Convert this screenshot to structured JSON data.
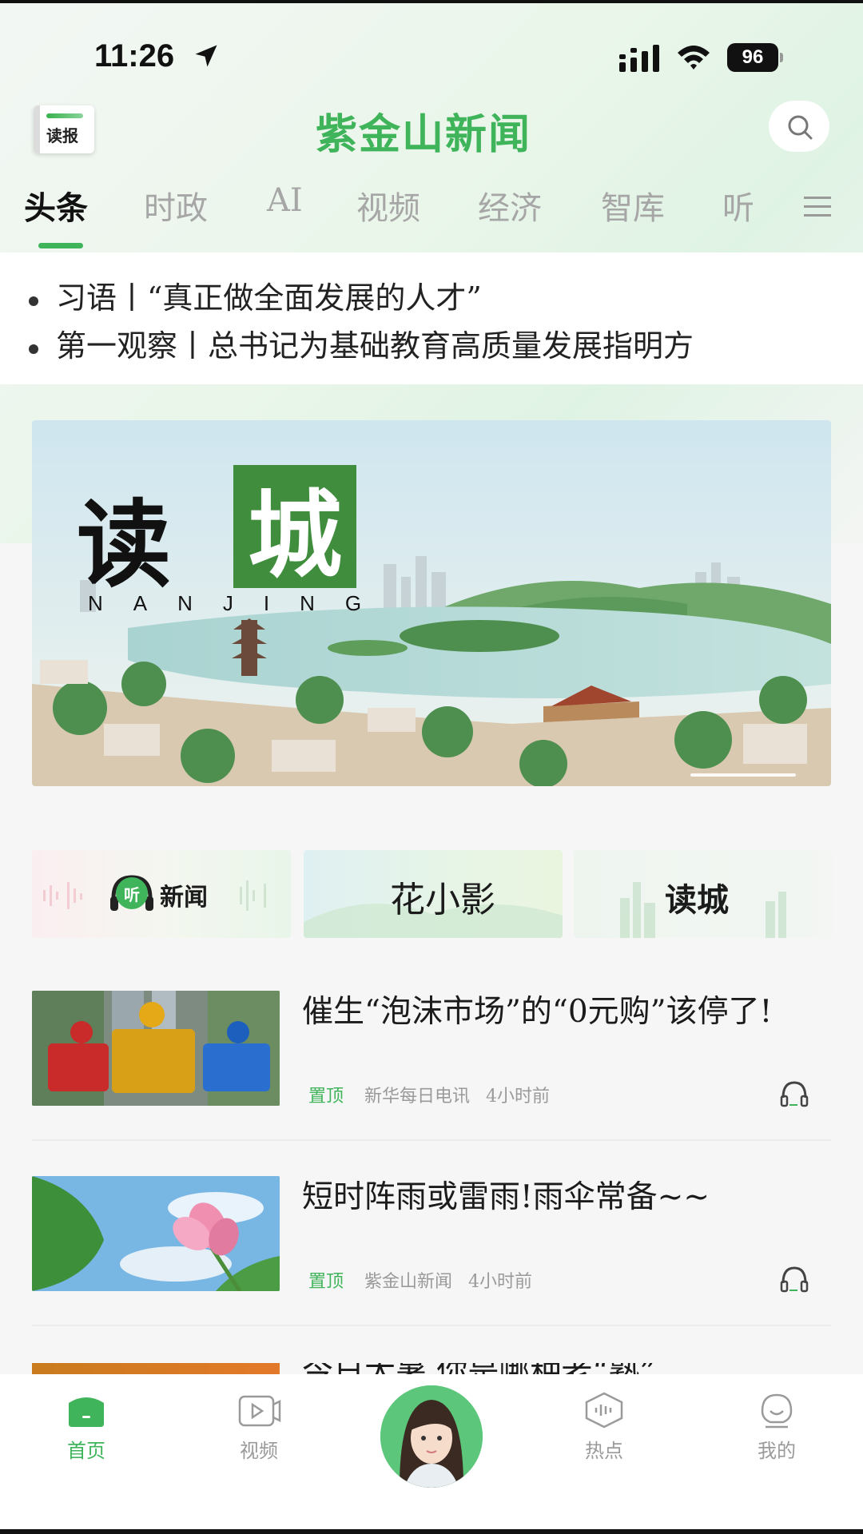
{
  "status_bar": {
    "time": "11:26",
    "battery": "96"
  },
  "header": {
    "read_label": "读报",
    "app_name": "紫金山新闻"
  },
  "tabs": [
    {
      "label": "头条",
      "active": true
    },
    {
      "label": "时政",
      "active": false
    },
    {
      "label": "AI",
      "active": false
    },
    {
      "label": "视频",
      "active": false
    },
    {
      "label": "经济",
      "active": false
    },
    {
      "label": "智库",
      "active": false
    },
    {
      "label": "听",
      "active": false
    }
  ],
  "headlines": [
    "习语丨“真正做全面发展的人才”",
    "第一观察丨总书记为基础教育高质量发展指明方"
  ],
  "banner": {
    "title_part1": "读",
    "title_part2": "城",
    "subtitle": "NANJING"
  },
  "shortcuts": [
    {
      "label": "新闻",
      "badge": "听"
    },
    {
      "label": "花小影"
    },
    {
      "label": "读城"
    }
  ],
  "news": [
    {
      "title": "催生“泡沫市场”的“0元购”该停了!",
      "pin": "置顶",
      "source": "新华每日电讯",
      "time": "4小时前"
    },
    {
      "title": "短时阵雨或雷雨!雨伞常备~~",
      "pin": "置顶",
      "source": "紫金山新闻",
      "time": "4小时前"
    },
    {
      "title": "今日大暑,你是哪种老“熟”"
    }
  ],
  "tabbar": [
    {
      "label": "首页",
      "active": true
    },
    {
      "label": "视频",
      "active": false
    },
    {
      "label": "热点",
      "active": false
    },
    {
      "label": "我的",
      "active": false
    }
  ],
  "colors": {
    "accent": "#3fb45a",
    "inactive": "#a6a6a6"
  }
}
